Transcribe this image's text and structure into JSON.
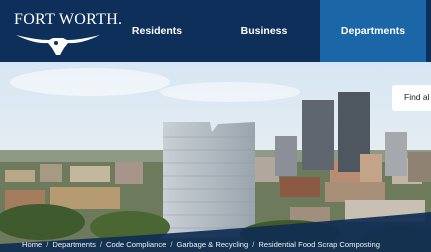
{
  "header": {
    "logo_text": "FORT WORTH.",
    "nav": [
      {
        "label": "Residents"
      },
      {
        "label": "Business"
      },
      {
        "label": "Departments",
        "active": true
      }
    ]
  },
  "search": {
    "text": "Find al"
  },
  "breadcrumb": [
    "Home",
    "Departments",
    "Code Compliance",
    "Garbage & Recycling",
    "Residential Food Scrap Composting"
  ],
  "colors": {
    "header_bg": "#0e2f5a",
    "active_nav_bg": "#1b66a7"
  }
}
